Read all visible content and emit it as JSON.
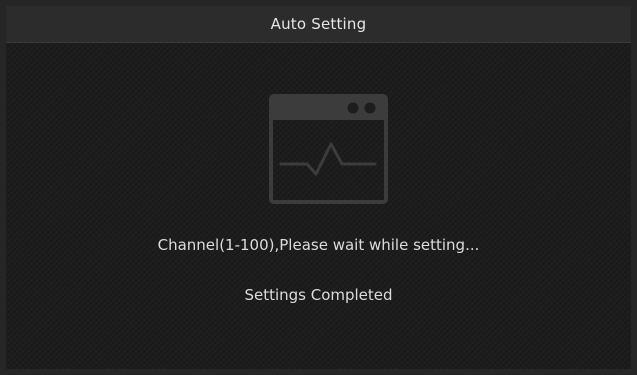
{
  "dialog": {
    "title": "Auto Setting",
    "progress_text": "Channel(1-100),Please wait while setting...",
    "completed_text": "Settings Completed"
  },
  "icons": {
    "illustration": "monitor-waveform-icon"
  },
  "colors": {
    "background": "#1d1d1d",
    "title_bar": "#2c2c2c",
    "text": "#dcdcdc",
    "icon": "#3b3b3b"
  }
}
